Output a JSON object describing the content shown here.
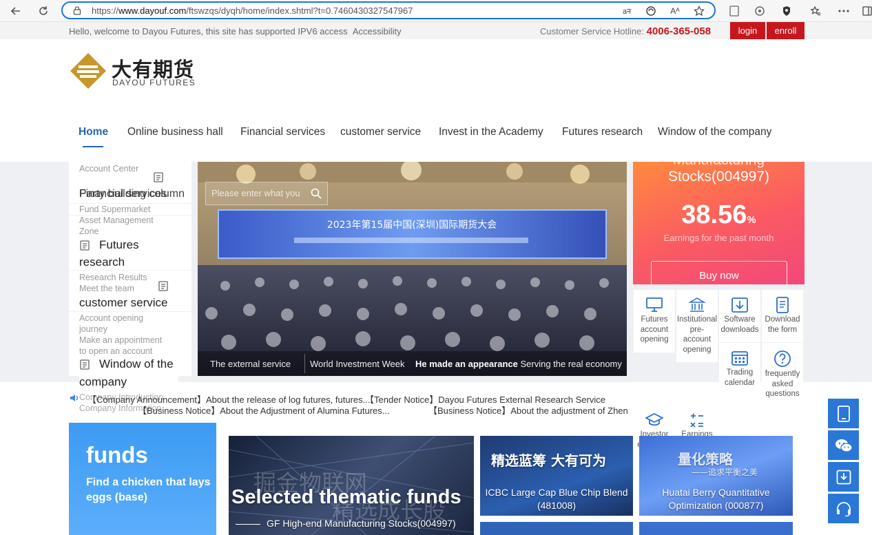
{
  "browser": {
    "url_prefix": "https://",
    "url_host": "www.dayouf.com",
    "url_path": "/ftswzqs/dyqh/home/index.shtml?t=0.7460430327547967",
    "read_aloud_label": "Aᴬ",
    "translate_label": "aन"
  },
  "topbar": {
    "welcome": "Hello, welcome to Dayou Futures, this site has supported IPV6 access",
    "accessibility": "Accessibility",
    "hotline_label": "Customer Service Hotline: ",
    "hotline_number": "4006-365-058",
    "login": "login",
    "enroll": "enroll"
  },
  "logo": {
    "cn": "大有期货",
    "en": "DAYOU FUTURES"
  },
  "nav": [
    "Home",
    "Online business hall",
    "Financial services",
    "customer service",
    "Invest in the Academy",
    "Futures research",
    "Window of the company"
  ],
  "sidemenu": {
    "account_center": "Account Center",
    "overlap_a": "Financial services",
    "overlap_b": "Party building column",
    "fund_supermarket": "Fund Supermarket",
    "asset_mgmt_1": "Asset Management",
    "asset_mgmt_2": "Zone",
    "futures_research_1": "Futures",
    "futures_research_2": "research",
    "research_results": "Research Results",
    "meet_team": "Meet the team",
    "customer_service": "customer service",
    "acct_journey_1": "Account opening",
    "acct_journey_2": "journey",
    "appointment_1": "Make an appointment",
    "appointment_2": "to open an account",
    "window_1": "Window of the",
    "window_2": "company",
    "company_intro": "Company Introduction",
    "company_info": "Company Information"
  },
  "search": {
    "placeholder": "Please enter what you"
  },
  "banner": {
    "screen_title": "2023年第15届中国(深圳)国际期货大会",
    "caption_1": "The external service",
    "caption_2": "World Investment Week",
    "caption_3_bold": "He made an appearance",
    "caption_3_rest": " Serving the real economy"
  },
  "promo": {
    "title_partial": "Manufacturing",
    "title": "Stocks(004997)",
    "percent": "38.56",
    "percent_unit": "%",
    "label": "Earnings for the past month",
    "buy": "Buy now"
  },
  "tiles": {
    "futures_account": [
      "Futures",
      "account",
      "opening"
    ],
    "institutional": [
      "Institutional",
      "pre-",
      "account",
      "opening"
    ],
    "software": [
      "Software",
      "downloads"
    ],
    "download_form": [
      "Download",
      "the form"
    ],
    "trading_calendar": [
      "Trading",
      "calendar"
    ],
    "faq": [
      "frequently",
      "asked",
      "questions"
    ],
    "investor_edu": [
      "Investor",
      "education"
    ],
    "earnings_inquiry": [
      "Earnings",
      "inquiry"
    ]
  },
  "announcements": {
    "a1": "【Company Announcement】About the release of log futures, futures...",
    "a2": "【Tender Notice】Dayou Futures External Research Service",
    "a3": "【Business Notice】About the Adjustment of Alumina Futures...",
    "a4": "【Business Notice】About the adjustment of Zhen"
  },
  "funds": {
    "title": "funds",
    "desc_1": "Find a chicken that lays",
    "desc_2": "eggs (base)"
  },
  "cards": {
    "thematic_title": "Selected thematic funds",
    "thematic_bg": "掘金物联网",
    "thematic_bg2": "精选成长股",
    "thematic_sub": "GF High-end Manufacturing Stocks(004997)",
    "icbc_cn": "精选蓝筹  大有可为",
    "icbc_1": "ICBC Large Cap Blue Chip Blend",
    "icbc_2": "(481008)",
    "huatai_cn": "量化策略",
    "huatai_cn2": "——追求平衡之美",
    "huatai_1": "Huatai Berry Quantitative",
    "huatai_2": "Optimization (000877)"
  },
  "colors": {
    "brand_red": "#c8161d",
    "brand_blue": "#2463b0",
    "float_blue": "#2a77d6"
  }
}
